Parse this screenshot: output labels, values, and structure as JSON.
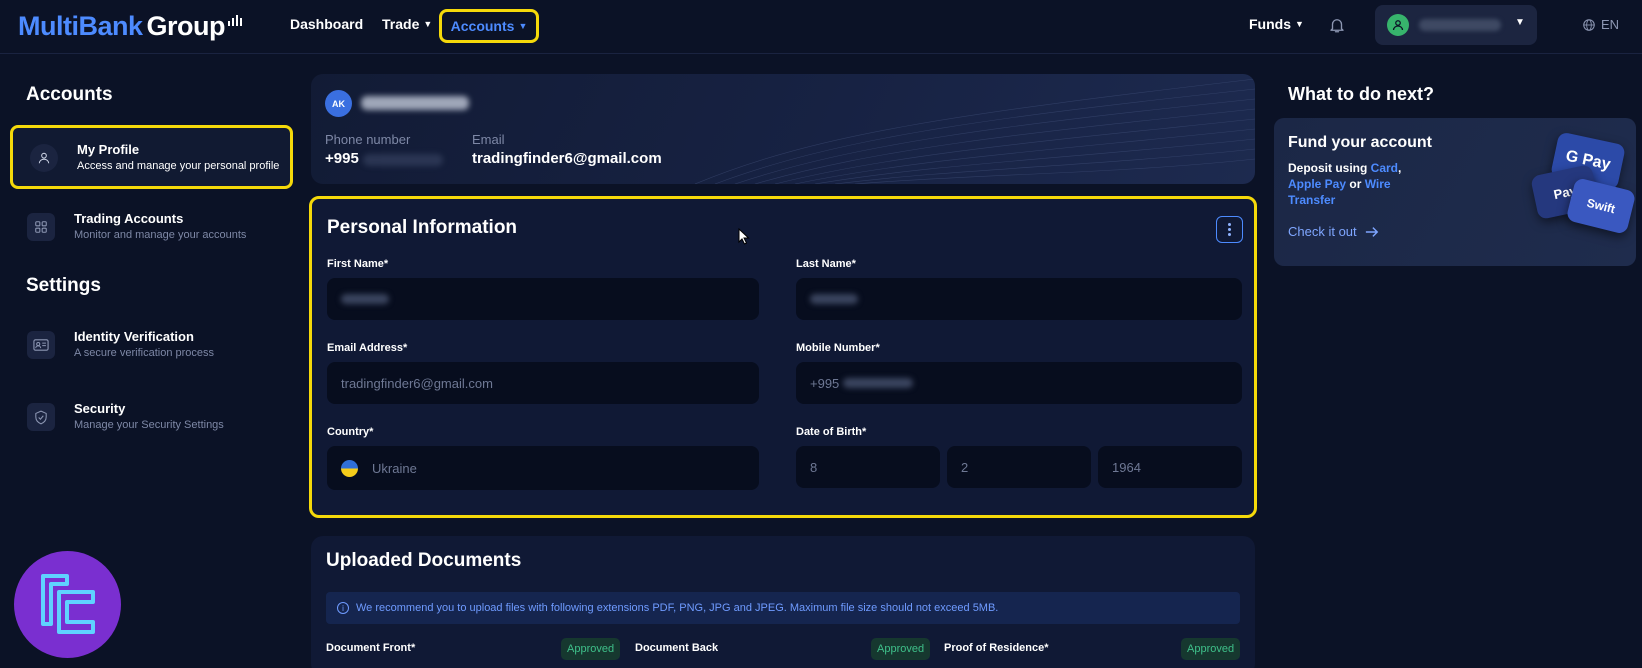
{
  "header": {
    "logo_primary": "MultiBank",
    "logo_secondary": "Group",
    "nav": {
      "dashboard": "Dashboard",
      "trade": "Trade",
      "accounts": "Accounts",
      "funds": "Funds"
    },
    "language": "EN"
  },
  "sidebar": {
    "accounts_heading": "Accounts",
    "settings_heading": "Settings",
    "items": [
      {
        "title": "My Profile",
        "subtitle": "Access and manage your personal profile"
      },
      {
        "title": "Trading Accounts",
        "subtitle": "Monitor and manage your accounts"
      },
      {
        "title": "Identity Verification",
        "subtitle": "A secure verification process"
      },
      {
        "title": "Security",
        "subtitle": "Manage your Security Settings"
      }
    ]
  },
  "profile": {
    "initials": "AK",
    "phone_label": "Phone number",
    "phone_value": "+995",
    "email_label": "Email",
    "email_value": "tradingfinder6@gmail.com"
  },
  "personal_info": {
    "title": "Personal Information",
    "first_name_label": "First Name*",
    "last_name_label": "Last Name*",
    "email_label": "Email Address*",
    "email_value": "tradingfinder6@gmail.com",
    "mobile_label": "Mobile Number*",
    "mobile_value": "+995",
    "country_label": "Country*",
    "country_value": "Ukraine",
    "dob_label": "Date of Birth*",
    "dob_day": "8",
    "dob_month": "2",
    "dob_year": "1964"
  },
  "documents": {
    "title": "Uploaded Documents",
    "notice": "We recommend you to upload files with following extensions PDF, PNG, JPG and JPEG. Maximum file size should not exceed 5MB.",
    "items": [
      {
        "label": "Document Front*",
        "status": "Approved"
      },
      {
        "label": "Document Back",
        "status": "Approved"
      },
      {
        "label": "Proof of Residence*",
        "status": "Approved"
      }
    ]
  },
  "next": {
    "heading": "What to do next?",
    "card_title": "Fund your account",
    "desc_prefix": "Deposit using ",
    "link_card": "Card",
    "comma": ",",
    "link_applepay": "Apple Pay",
    "or": " or ",
    "link_wire": "Wire Transfer",
    "cta": "Check it out",
    "gpay_label": "G Pay",
    "applepay_label": "Pay",
    "swift_label": "Swift"
  },
  "colors": {
    "background": "#0b1226",
    "accent": "#4d8bff",
    "highlight": "#f5d90a",
    "approved": "#3fc08a"
  }
}
